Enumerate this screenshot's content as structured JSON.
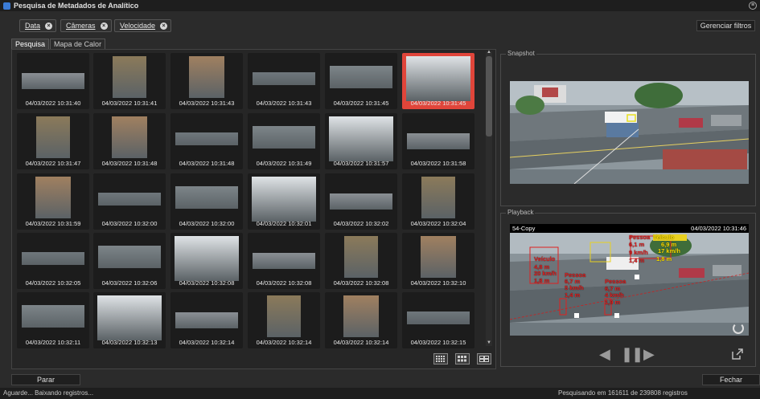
{
  "window": {
    "title": "Pesquisa de Metadados de Analítico"
  },
  "filters": [
    {
      "label": "Data"
    },
    {
      "label": "Câmeras"
    },
    {
      "label": "Velocidade"
    }
  ],
  "clear_filters_label": "Gerenciar filtros",
  "tabs": [
    {
      "label": "Pesquisa",
      "active": true
    },
    {
      "label": "Mapa de Calor",
      "active": false
    }
  ],
  "results": [
    "04/03/2022 10:31:40",
    "04/03/2022 10:31:41",
    "04/03/2022 10:31:43",
    "04/03/2022 10:31:43",
    "04/03/2022 10:31:45",
    "04/03/2022 10:31:45",
    "04/03/2022 10:31:47",
    "04/03/2022 10:31:48",
    "04/03/2022 10:31:48",
    "04/03/2022 10:31:49",
    "04/03/2022 10:31:57",
    "04/03/2022 10:31:58",
    "04/03/2022 10:31:59",
    "04/03/2022 10:32:00",
    "04/03/2022 10:32:00",
    "04/03/2022 10:32:01",
    "04/03/2022 10:32:02",
    "04/03/2022 10:32:04",
    "04/03/2022 10:32:05",
    "04/03/2022 10:32:06",
    "04/03/2022 10:32:08",
    "04/03/2022 10:32:08",
    "04/03/2022 10:32:08",
    "04/03/2022 10:32:10",
    "04/03/2022 10:32:11",
    "04/03/2022 10:32:13",
    "04/03/2022 10:32:14",
    "04/03/2022 10:32:14",
    "04/03/2022 10:32:14",
    "04/03/2022 10:32:15"
  ],
  "selected_index": 5,
  "snapshot": {
    "legend": "Snapshot"
  },
  "playback": {
    "legend": "Playback",
    "camera": "54-Copy",
    "timestamp": "04/03/2022 10:31:46",
    "overlays": [
      {
        "text": "Pessoa",
        "color": "#e02020"
      },
      {
        "text": "Veículo",
        "color": "#ffe000"
      },
      {
        "text": "6,9 m",
        "color": "#ffe000"
      },
      {
        "text": "17 km/h",
        "color": "#ffe000"
      },
      {
        "text": "1,8 m",
        "color": "#ffe000"
      },
      {
        "text": "Veículo",
        "color": "#e02020"
      },
      {
        "text": "4,8 m",
        "color": "#e02020"
      },
      {
        "text": "20 km/h",
        "color": "#e02020"
      },
      {
        "text": "1,8 m",
        "color": "#e02020"
      },
      {
        "text": "Pessoa",
        "color": "#e02020"
      },
      {
        "text": "6,7 m",
        "color": "#e02020"
      },
      {
        "text": "5 km/h",
        "color": "#e02020"
      },
      {
        "text": "1,4 m",
        "color": "#e02020"
      },
      {
        "text": "Pessoa",
        "color": "#e02020"
      },
      {
        "text": "6,7 m",
        "color": "#e02020"
      },
      {
        "text": "4 km/h",
        "color": "#e02020"
      },
      {
        "text": "1,9 m",
        "color": "#e02020"
      },
      {
        "text": "6,1 m",
        "color": "#e02020"
      },
      {
        "text": "9 km/h",
        "color": "#e02020"
      },
      {
        "text": "1,4 m",
        "color": "#e02020"
      }
    ]
  },
  "stop_label": "Parar",
  "close_label": "Fechar",
  "status_left": "Aguarde... Baixando registros...",
  "status_right": "Pesquisando em 161611 de 239808 registros",
  "colors": {
    "accent_selected": "#e0453a",
    "bg": "#2b2b2b"
  }
}
